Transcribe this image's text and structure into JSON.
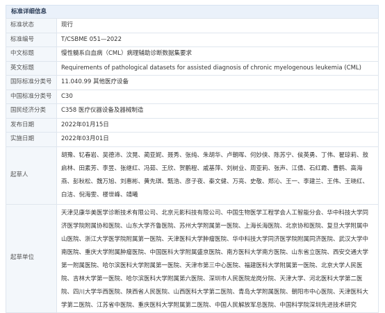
{
  "section_title": "标准详细信息",
  "rows": [
    {
      "label": "标准状态",
      "value": "现行"
    },
    {
      "label": "标准编号",
      "value": "T/CSBME 051—2022"
    },
    {
      "label": "中文标题",
      "value": "慢性髓系白血病（CML）病理辅助诊断数据集要求"
    },
    {
      "label": "英文标题",
      "value": "Requirements of pathological datasets for assisted diagnosis of chronic myelogenous leukemia (CML)"
    },
    {
      "label": "国际标准分类号",
      "value": "11.040.99 其他医疗设备"
    },
    {
      "label": "中国标准分类号",
      "value": "C30"
    },
    {
      "label": "国民经济分类",
      "value": "C358 医疗仪器设备及器械制造"
    },
    {
      "label": "发布日期",
      "value": "2022年01月15日"
    },
    {
      "label": "实施日期",
      "value": "2022年03月01日"
    }
  ],
  "drafters": {
    "label": "起草人",
    "value": "胡豫、钇春岩、吴德沛、汶晃、蔺亚妮、聂秀、张纯、朱胡华、卢朝晖、何妙侠、陈苏宁、侯英勇、丁伟、翟琼莉、敖启林、田素芳、李昱、张继红、冯茹、王欣、贺鹏程、戚基萍、刘树业、周亚莉、张声、江倩、石红霞、曹鹤、高海燕、彭秋松、魏万旭、刘惠彬、黄先琪、甄浩、彦子夜、秦文健、万亮、史敬、郑沁、王一、李建兰、王伟、王晓红、白洁、倪海雯、楼世峰、靖曦"
  },
  "units": {
    "label": "起草单位",
    "value": "天津见康华美医学诊断技术有限公司、北京元影科技有限公司、中国生物医学工程学会人工智能分会、华中科技大学同济医学院附属协和医院、山东大学齐鲁医院、苏州大学附属第一医院、上海长海医院、北京协和医院、复旦大学附属中山医院、浙江大学医学院附属第一医院、天津医科大学肿瘤医院、华中科技大学同济医学院附属同济医院、武汉大学中南医院、重庆大学附属肿瘤医院、中国医科大学附属盛京医院、南方医科大学南方医院、山东省立医院、西安交通大学第一附属医院、哈尔滨医科大学附属第一医院、天津市第三中心医院、福建医科大学附属第一医院、北京大学人民医院、吉林大学第一医院、哈尔滨医科大学附属第六医院、深圳市人民医院龙岗分院、天津大学、河北医科大学第二医院、四川大学华西医院、陕西省人民医院、山西医科大学第二医院、青岛大学附属医院、朝阳市中心医院、天津医科大学第二医院、江苏省中医院、重庆医科大学附属第二医院、中国人民解放军总医院、中国科学院深圳先进技术研究"
  }
}
